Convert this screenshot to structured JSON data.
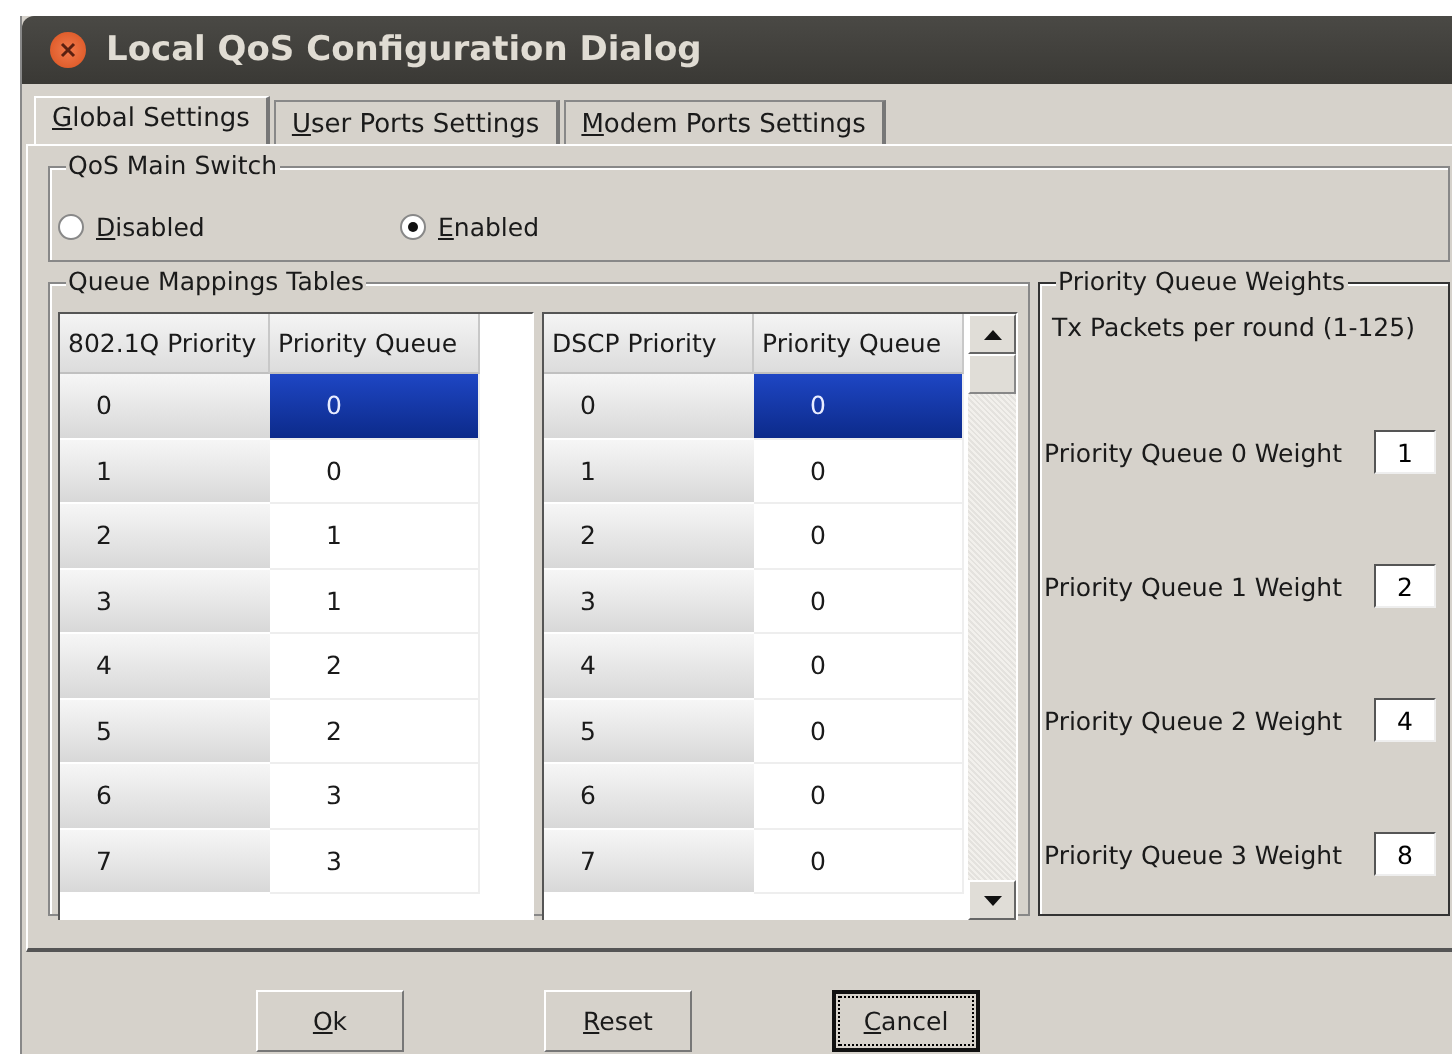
{
  "window": {
    "title": "Local QoS Configuration Dialog"
  },
  "tabs": [
    {
      "label": "Global Settings",
      "selected": true
    },
    {
      "label": "User Ports Settings",
      "selected": false
    },
    {
      "label": "Modem Ports Settings",
      "selected": false
    }
  ],
  "qos_switch": {
    "title": "QoS Main Switch",
    "options": [
      {
        "label": "Disabled",
        "selected": false
      },
      {
        "label": "Enabled",
        "selected": true
      }
    ]
  },
  "queue_mappings": {
    "title": "Queue Mappings Tables",
    "tables": [
      {
        "columns": [
          "802.1Q Priority",
          "Priority Queue"
        ],
        "scrollbar": false,
        "rows": [
          {
            "priority": "0",
            "queue": "0",
            "selected": true
          },
          {
            "priority": "1",
            "queue": "0",
            "selected": false
          },
          {
            "priority": "2",
            "queue": "1",
            "selected": false
          },
          {
            "priority": "3",
            "queue": "1",
            "selected": false
          },
          {
            "priority": "4",
            "queue": "2",
            "selected": false
          },
          {
            "priority": "5",
            "queue": "2",
            "selected": false
          },
          {
            "priority": "6",
            "queue": "3",
            "selected": false
          },
          {
            "priority": "7",
            "queue": "3",
            "selected": false
          }
        ]
      },
      {
        "columns": [
          "DSCP Priority",
          "Priority Queue"
        ],
        "scrollbar": true,
        "rows": [
          {
            "priority": "0",
            "queue": "0",
            "selected": true
          },
          {
            "priority": "1",
            "queue": "0",
            "selected": false
          },
          {
            "priority": "2",
            "queue": "0",
            "selected": false
          },
          {
            "priority": "3",
            "queue": "0",
            "selected": false
          },
          {
            "priority": "4",
            "queue": "0",
            "selected": false
          },
          {
            "priority": "5",
            "queue": "0",
            "selected": false
          },
          {
            "priority": "6",
            "queue": "0",
            "selected": false
          },
          {
            "priority": "7",
            "queue": "0",
            "selected": false
          }
        ]
      }
    ]
  },
  "weights": {
    "title": "Priority Queue Weights",
    "subtitle": "Tx Packets per round (1-125)",
    "items": [
      {
        "label": "Priority Queue 0 Weight",
        "value": "1"
      },
      {
        "label": "Priority Queue 1 Weight",
        "value": "2"
      },
      {
        "label": "Priority Queue 2 Weight",
        "value": "4"
      },
      {
        "label": "Priority Queue 3 Weight",
        "value": "8"
      }
    ]
  },
  "buttons": [
    {
      "label": "Ok",
      "focused": false
    },
    {
      "label": "Reset",
      "focused": false
    },
    {
      "label": "Cancel",
      "focused": true
    }
  ]
}
